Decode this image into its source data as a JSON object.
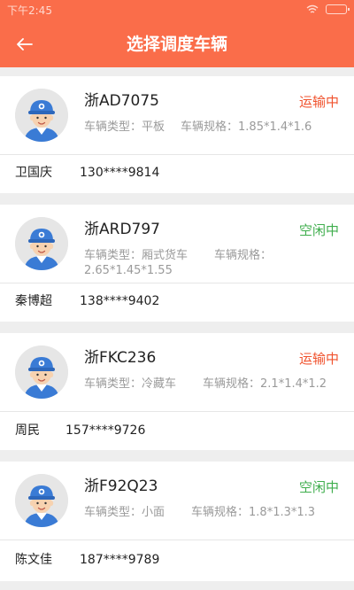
{
  "status_bar": {
    "time": "下午2:45"
  },
  "header": {
    "title": "选择调度车辆"
  },
  "vehicles": [
    {
      "plate": "浙AD7075",
      "status": "运输中",
      "status_type": "busy",
      "type_label": "车辆类型：平板",
      "spec_label": "车辆规格：1.85*1.4*1.6",
      "driver": "卫国庆",
      "phone": "130****9814"
    },
    {
      "plate": "浙ARD797",
      "status": "空闲中",
      "status_type": "idle",
      "type_label": "车辆类型：厢式货车",
      "spec_label": "车辆规格：2.65*1.45*1.55",
      "driver": "秦博超",
      "phone": "138****9402"
    },
    {
      "plate": "浙FKC236",
      "status": "运输中",
      "status_type": "busy",
      "type_label": "车辆类型：冷藏车",
      "spec_label": "车辆规格：2.1*1.4*1.2",
      "driver": "周民",
      "phone": "157****9726"
    },
    {
      "plate": "浙F92Q23",
      "status": "空闲中",
      "status_type": "idle",
      "type_label": "车辆类型：小面",
      "spec_label": "车辆规格：1.8*1.3*1.3",
      "driver": "陈文佳",
      "phone": "187****9789"
    }
  ],
  "colors": {
    "accent": "#fa6d4a",
    "busy": "#f0522d",
    "idle": "#3fae4d"
  }
}
